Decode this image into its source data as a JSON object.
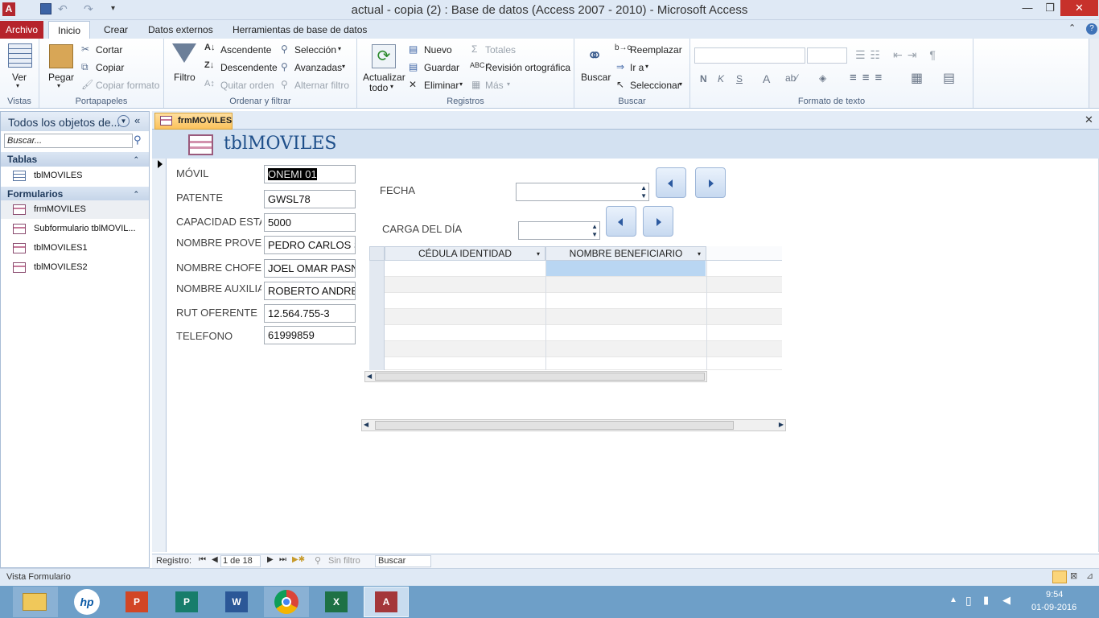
{
  "window": {
    "title": "actual - copia (2) : Base de datos (Access 2007 - 2010) - Microsoft Access"
  },
  "ribbon_tabs": [
    "Archivo",
    "Inicio",
    "Crear",
    "Datos externos",
    "Herramientas de base de datos"
  ],
  "ribbon": {
    "vistas": {
      "group": "Vistas",
      "ver": "Ver"
    },
    "portapapeles": {
      "group": "Portapapeles",
      "pegar": "Pegar",
      "cortar": "Cortar",
      "copiar": "Copiar",
      "copiar_formato": "Copiar formato"
    },
    "ordenar": {
      "group": "Ordenar y filtrar",
      "filtro": "Filtro",
      "ascendente": "Ascendente",
      "descendente": "Descendente",
      "quitar_orden": "Quitar orden",
      "seleccion": "Selección",
      "avanzadas": "Avanzadas",
      "alternar_filtro": "Alternar filtro"
    },
    "registros": {
      "group": "Registros",
      "actualizar": "Actualizar",
      "todo": "todo",
      "nuevo": "Nuevo",
      "guardar": "Guardar",
      "eliminar": "Eliminar",
      "totales": "Totales",
      "revision": "Revisión ortográfica",
      "mas": "Más"
    },
    "buscar": {
      "group": "Buscar",
      "buscar": "Buscar",
      "reemplazar": "Reemplazar",
      "ir_a": "Ir a",
      "seleccionar": "Seleccionar"
    },
    "formato": {
      "group": "Formato de texto",
      "bold": "N",
      "italic": "K",
      "underline": "S",
      "font_color": "A"
    }
  },
  "nav": {
    "header": "Todos los objetos de...",
    "search_placeholder": "Buscar...",
    "sections": [
      {
        "title": "Tablas",
        "items": [
          "tblMOVILES"
        ]
      },
      {
        "title": "Formularios",
        "items": [
          "frmMOVILES",
          "Subformulario tblMOVIL...",
          "tblMOVILES1",
          "tblMOVILES2"
        ]
      }
    ]
  },
  "document_tab": "frmMOVILES",
  "form": {
    "title": "tblMOVILES",
    "fields": [
      {
        "label": "MÓVIL",
        "value": "ONEMI 01"
      },
      {
        "label": "PATENTE",
        "value": "GWSL78"
      },
      {
        "label": "CAPACIDAD ESTA",
        "value": "5000"
      },
      {
        "label": "NOMBRE PROVEE",
        "value": "PEDRO CARLOS S"
      },
      {
        "label": "NOMBRE CHOFER",
        "value": "JOEL OMAR PASN"
      },
      {
        "label": "NOMBRE AUXILIA",
        "value": "ROBERTO ANDRE"
      },
      {
        "label": "RUT OFERENTE",
        "value": "12.564.755-3"
      },
      {
        "label": "TELEFONO",
        "value": "61999859"
      }
    ],
    "fecha_label": "FECHA",
    "carga_label": "CARGA DEL DÍA",
    "subform_columns": [
      "CÉDULA IDENTIDAD",
      "NOMBRE BENEFICIARIO"
    ]
  },
  "record_nav": {
    "label": "Registro:",
    "position": "1 de 18",
    "filter": "Sin filtro",
    "search": "Buscar"
  },
  "status": {
    "text": "Vista Formulario"
  },
  "clock": {
    "time": "9:54",
    "date": "01-09-2016"
  }
}
